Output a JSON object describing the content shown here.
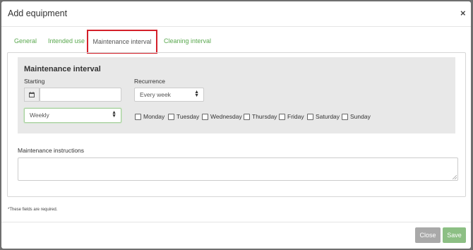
{
  "modal": {
    "title": "Add equipment",
    "close_icon": "×"
  },
  "tabs": [
    {
      "label": "General"
    },
    {
      "label": "Intended use"
    },
    {
      "label": "Maintenance interval",
      "active": true
    },
    {
      "label": "Cleaning interval"
    }
  ],
  "interval": {
    "section_title": "Maintenance interval",
    "starting_label": "Starting",
    "starting_value": "",
    "recurrence_label": "Recurrence",
    "recurrence_value": "Every week",
    "period_value": "Weekly",
    "days": [
      "Monday",
      "Tuesday",
      "Wednesday",
      "Thursday",
      "Friday",
      "Saturday",
      "Sunday"
    ]
  },
  "instructions": {
    "label": "Maintenance instructions",
    "value": ""
  },
  "footnote": "*These fields are required.",
  "buttons": {
    "close": "Close",
    "save": "Save"
  },
  "colors": {
    "accent_green": "#5aa84f",
    "save_button": "#8cbf84",
    "close_button": "#a9a9a9",
    "highlight_red": "#d4202a"
  }
}
